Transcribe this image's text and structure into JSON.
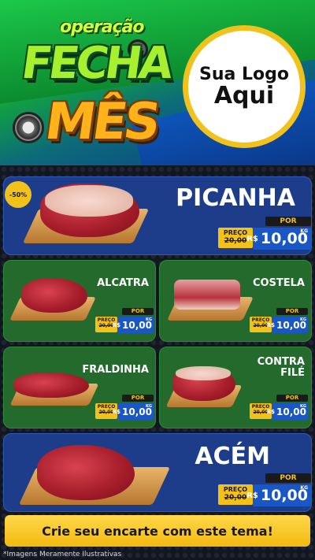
{
  "header": {
    "title_small": "operação",
    "title_main": "FECHA",
    "title_sub": "MÊS",
    "logo_line1": "Sua Logo",
    "logo_line2": "Aqui"
  },
  "discount_badge": "-50%",
  "products": [
    {
      "name": "PICANHA",
      "por": "POR",
      "de_label": "PREÇO",
      "old": "20,00",
      "currency": "R$",
      "price": "10,00",
      "unit": "KG"
    },
    {
      "name": "ALCATRA",
      "por": "POR",
      "de_label": "PREÇO",
      "old": "20,00",
      "currency": "R$",
      "price": "10,00",
      "unit": "KG"
    },
    {
      "name": "COSTELA",
      "por": "POR",
      "de_label": "PREÇO",
      "old": "20,00",
      "currency": "R$",
      "price": "10,00",
      "unit": "KG"
    },
    {
      "name": "FRALDINHA",
      "por": "POR",
      "de_label": "PREÇO",
      "old": "20,00",
      "currency": "R$",
      "price": "10,00",
      "unit": "KG"
    },
    {
      "name_l1": "CONTRA",
      "name_l2": "FILÉ",
      "por": "POR",
      "de_label": "PREÇO",
      "old": "20,00",
      "currency": "R$",
      "price": "10,00",
      "unit": "KG"
    },
    {
      "name": "ACÉM",
      "por": "POR",
      "de_label": "PREÇO",
      "old": "20,00",
      "currency": "R$",
      "price": "10,00",
      "unit": "KG"
    }
  ],
  "cta": "Crie seu encarte com este tema!",
  "footnote": "*Imagens Meramente Ilustrativas",
  "colors": {
    "blue_panel": "#1d3d8a",
    "green_panel": "#236a2c",
    "accent_yellow": "#f3c21a",
    "price_blue": "#1a57c6"
  }
}
